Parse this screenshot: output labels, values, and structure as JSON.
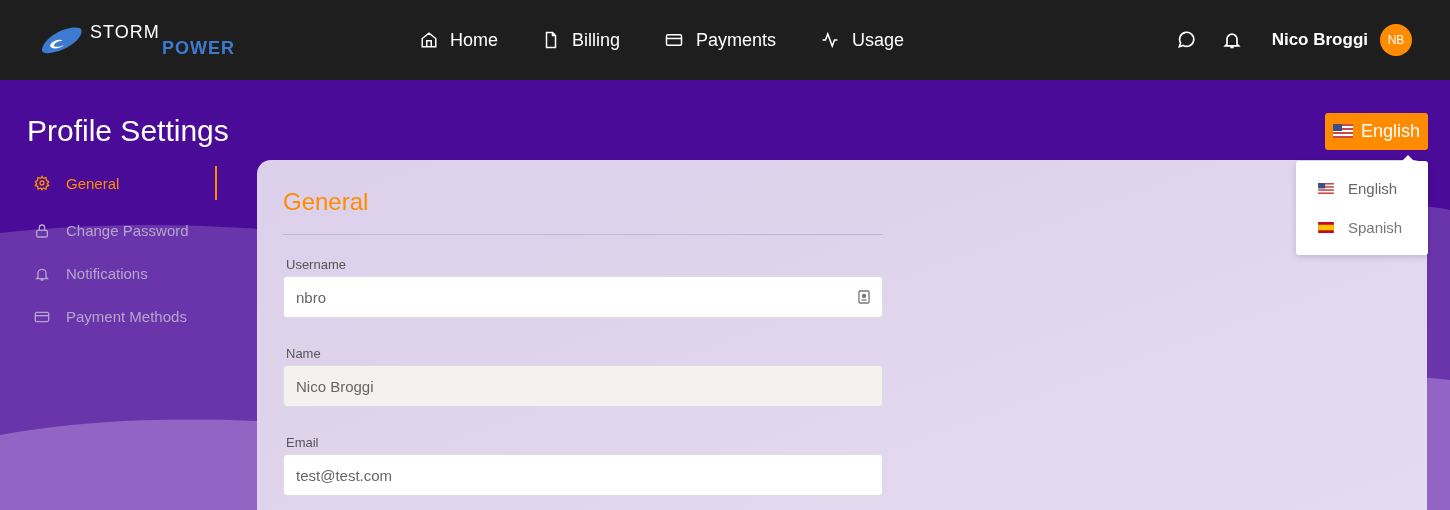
{
  "logo": {
    "line_1": "STORM",
    "line_2": "POWER"
  },
  "nav": [
    {
      "label": "Home",
      "kind": "home"
    },
    {
      "label": "Billing",
      "kind": "file"
    },
    {
      "label": "Payments",
      "kind": "card"
    },
    {
      "label": "Usage",
      "kind": "activity"
    }
  ],
  "user": {
    "name": "Nico Broggi",
    "initials": "NB"
  },
  "page_title": "Profile Settings",
  "language": {
    "label": "English",
    "kind": "us",
    "options": [
      {
        "label": "English",
        "kind": "us",
        "selected": true
      },
      {
        "label": "Spanish",
        "kind": "es",
        "selected": false
      }
    ]
  },
  "sidebar": {
    "items": [
      {
        "label": "General",
        "kind": "gear",
        "selected": true
      },
      {
        "label": "Change Password",
        "kind": "lock",
        "selected": false
      },
      {
        "label": "Notifications",
        "kind": "bell",
        "selected": false
      },
      {
        "label": "Payment Methods",
        "kind": "card",
        "selected": false
      }
    ]
  },
  "section_title": "General",
  "fields": [
    {
      "label": "Username",
      "value": "nbro",
      "disabled": false,
      "trailing_icon": true
    },
    {
      "label": "Name",
      "value": "Nico Broggi",
      "disabled": true,
      "trailing_icon": false
    },
    {
      "label": "Email",
      "value": "test@test.com",
      "disabled": false,
      "trailing_icon": false
    }
  ]
}
